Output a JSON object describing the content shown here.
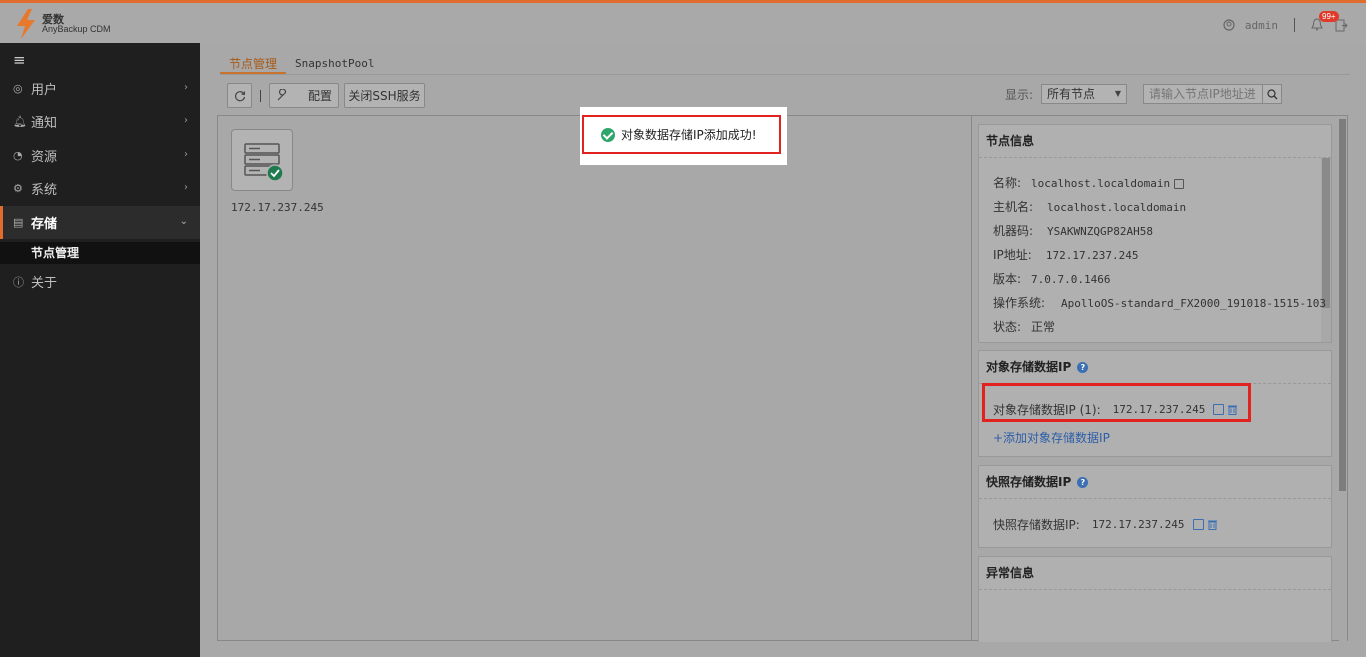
{
  "header": {
    "brand_cn": "爱数",
    "brand_en": "AnyBackup CDM",
    "user": "admin",
    "notifications_badge": "99+"
  },
  "sidebar": {
    "items": [
      {
        "label": "用户",
        "icon": "user-icon"
      },
      {
        "label": "通知",
        "icon": "bell-icon"
      },
      {
        "label": "资源",
        "icon": "pie-chart-icon"
      },
      {
        "label": "系统",
        "icon": "gear-icon"
      },
      {
        "label": "存储",
        "icon": "storage-icon",
        "active": true
      },
      {
        "label": "关于",
        "icon": "info-icon"
      }
    ],
    "sub_item": "节点管理"
  },
  "tabs": [
    {
      "label": "节点管理",
      "active": true
    },
    {
      "label": "SnapshotPool",
      "active": false
    }
  ],
  "toolbar": {
    "config_label": "配置",
    "ssh_label": "关闭SSH服务"
  },
  "filter": {
    "label": "显示:",
    "selected": "所有节点",
    "search_placeholder": "请输入节点IP地址进"
  },
  "node": {
    "ip": "172.17.237.245"
  },
  "node_info": {
    "title": "节点信息",
    "rows": [
      {
        "label": "名称:",
        "value": "localhost.localdomain"
      },
      {
        "label": "主机名:",
        "value": "localhost.localdomain"
      },
      {
        "label": "机器码:",
        "value": "YSAKWNZQGP82AH58"
      },
      {
        "label": "IP地址:",
        "value": "172.17.237.245"
      },
      {
        "label": "版本:",
        "value": "7.0.7.0.1466"
      },
      {
        "label": "操作系统:",
        "value": "ApolloOS-standard_FX2000_191018-1515-103"
      },
      {
        "label": "状态:",
        "value": "正常"
      }
    ]
  },
  "object_storage": {
    "title": "对象存储数据IP",
    "entry_label": "对象存储数据IP (1):",
    "entry_value": "172.17.237.245",
    "add_link": "+添加对象存储数据IP"
  },
  "snapshot_storage": {
    "title": "快照存储数据IP",
    "entry_label": "快照存储数据IP:",
    "entry_value": "172.17.237.245"
  },
  "exception": {
    "title": "异常信息"
  },
  "toast": {
    "message": "对象数据存储IP添加成功!"
  },
  "colors": {
    "accent": "#e06c2e",
    "highlight": "#e0231e",
    "success": "#2fa56b",
    "link": "#2d5ea8"
  }
}
